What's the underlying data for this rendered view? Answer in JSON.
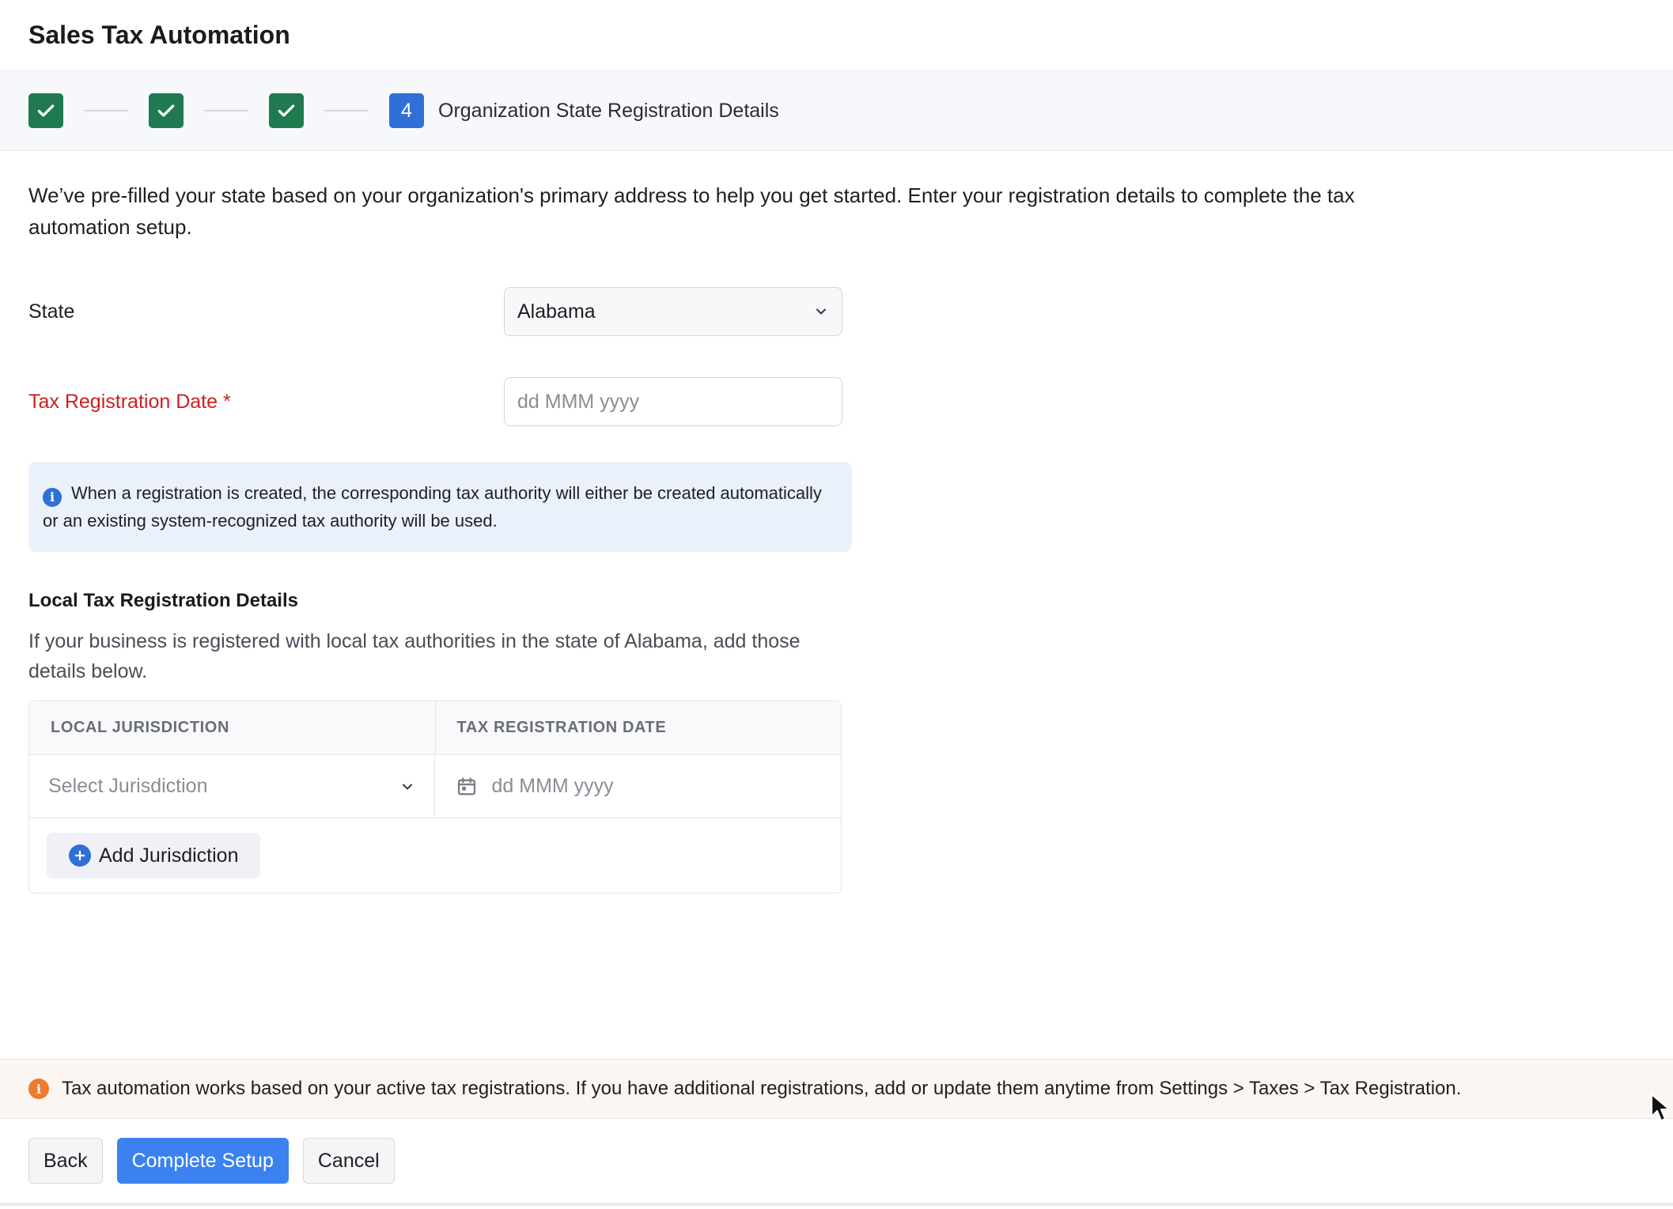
{
  "header": {
    "title": "Sales Tax Automation"
  },
  "stepper": {
    "completed_steps": 3,
    "current_step_number": "4",
    "current_step_title": "Organization State Registration Details"
  },
  "intro_text": "We’ve pre-filled your state based on your organization's primary address to help you get started. Enter your registration details to complete the tax automation setup.",
  "form": {
    "state_label": "State",
    "state_value": "Alabama",
    "registration_date_label": "Tax Registration Date *",
    "registration_date_placeholder": "dd MMM yyyy"
  },
  "info_box": {
    "icon": "info-icon",
    "text": "When a registration is created, the corresponding tax authority will either be created automatically or an existing system-recognized tax authority will be used."
  },
  "local_section": {
    "title": "Local Tax Registration Details",
    "description": "If your business is registered with local tax authorities in the state of Alabama, add those details below.",
    "columns": [
      "LOCAL JURISDICTION",
      "TAX REGISTRATION DATE"
    ],
    "row": {
      "jurisdiction_placeholder": "Select Jurisdiction",
      "date_placeholder": "dd MMM yyyy"
    },
    "add_button_label": "Add Jurisdiction"
  },
  "notice": {
    "icon": "warning-icon",
    "text": "Tax automation works based on your active tax registrations. If you have additional registrations, add or update them anytime from Settings > Taxes > Tax Registration."
  },
  "footer": {
    "back_label": "Back",
    "complete_label": "Complete Setup",
    "cancel_label": "Cancel"
  },
  "colors": {
    "step_done": "#1f7a4f",
    "step_current": "#2f6fd6",
    "primary_button": "#3b82f0",
    "required_label": "#cf1e1e",
    "info_background": "#eaf1fb",
    "notice_background": "#fbf6f1",
    "warning_icon": "#ef7c2c"
  }
}
